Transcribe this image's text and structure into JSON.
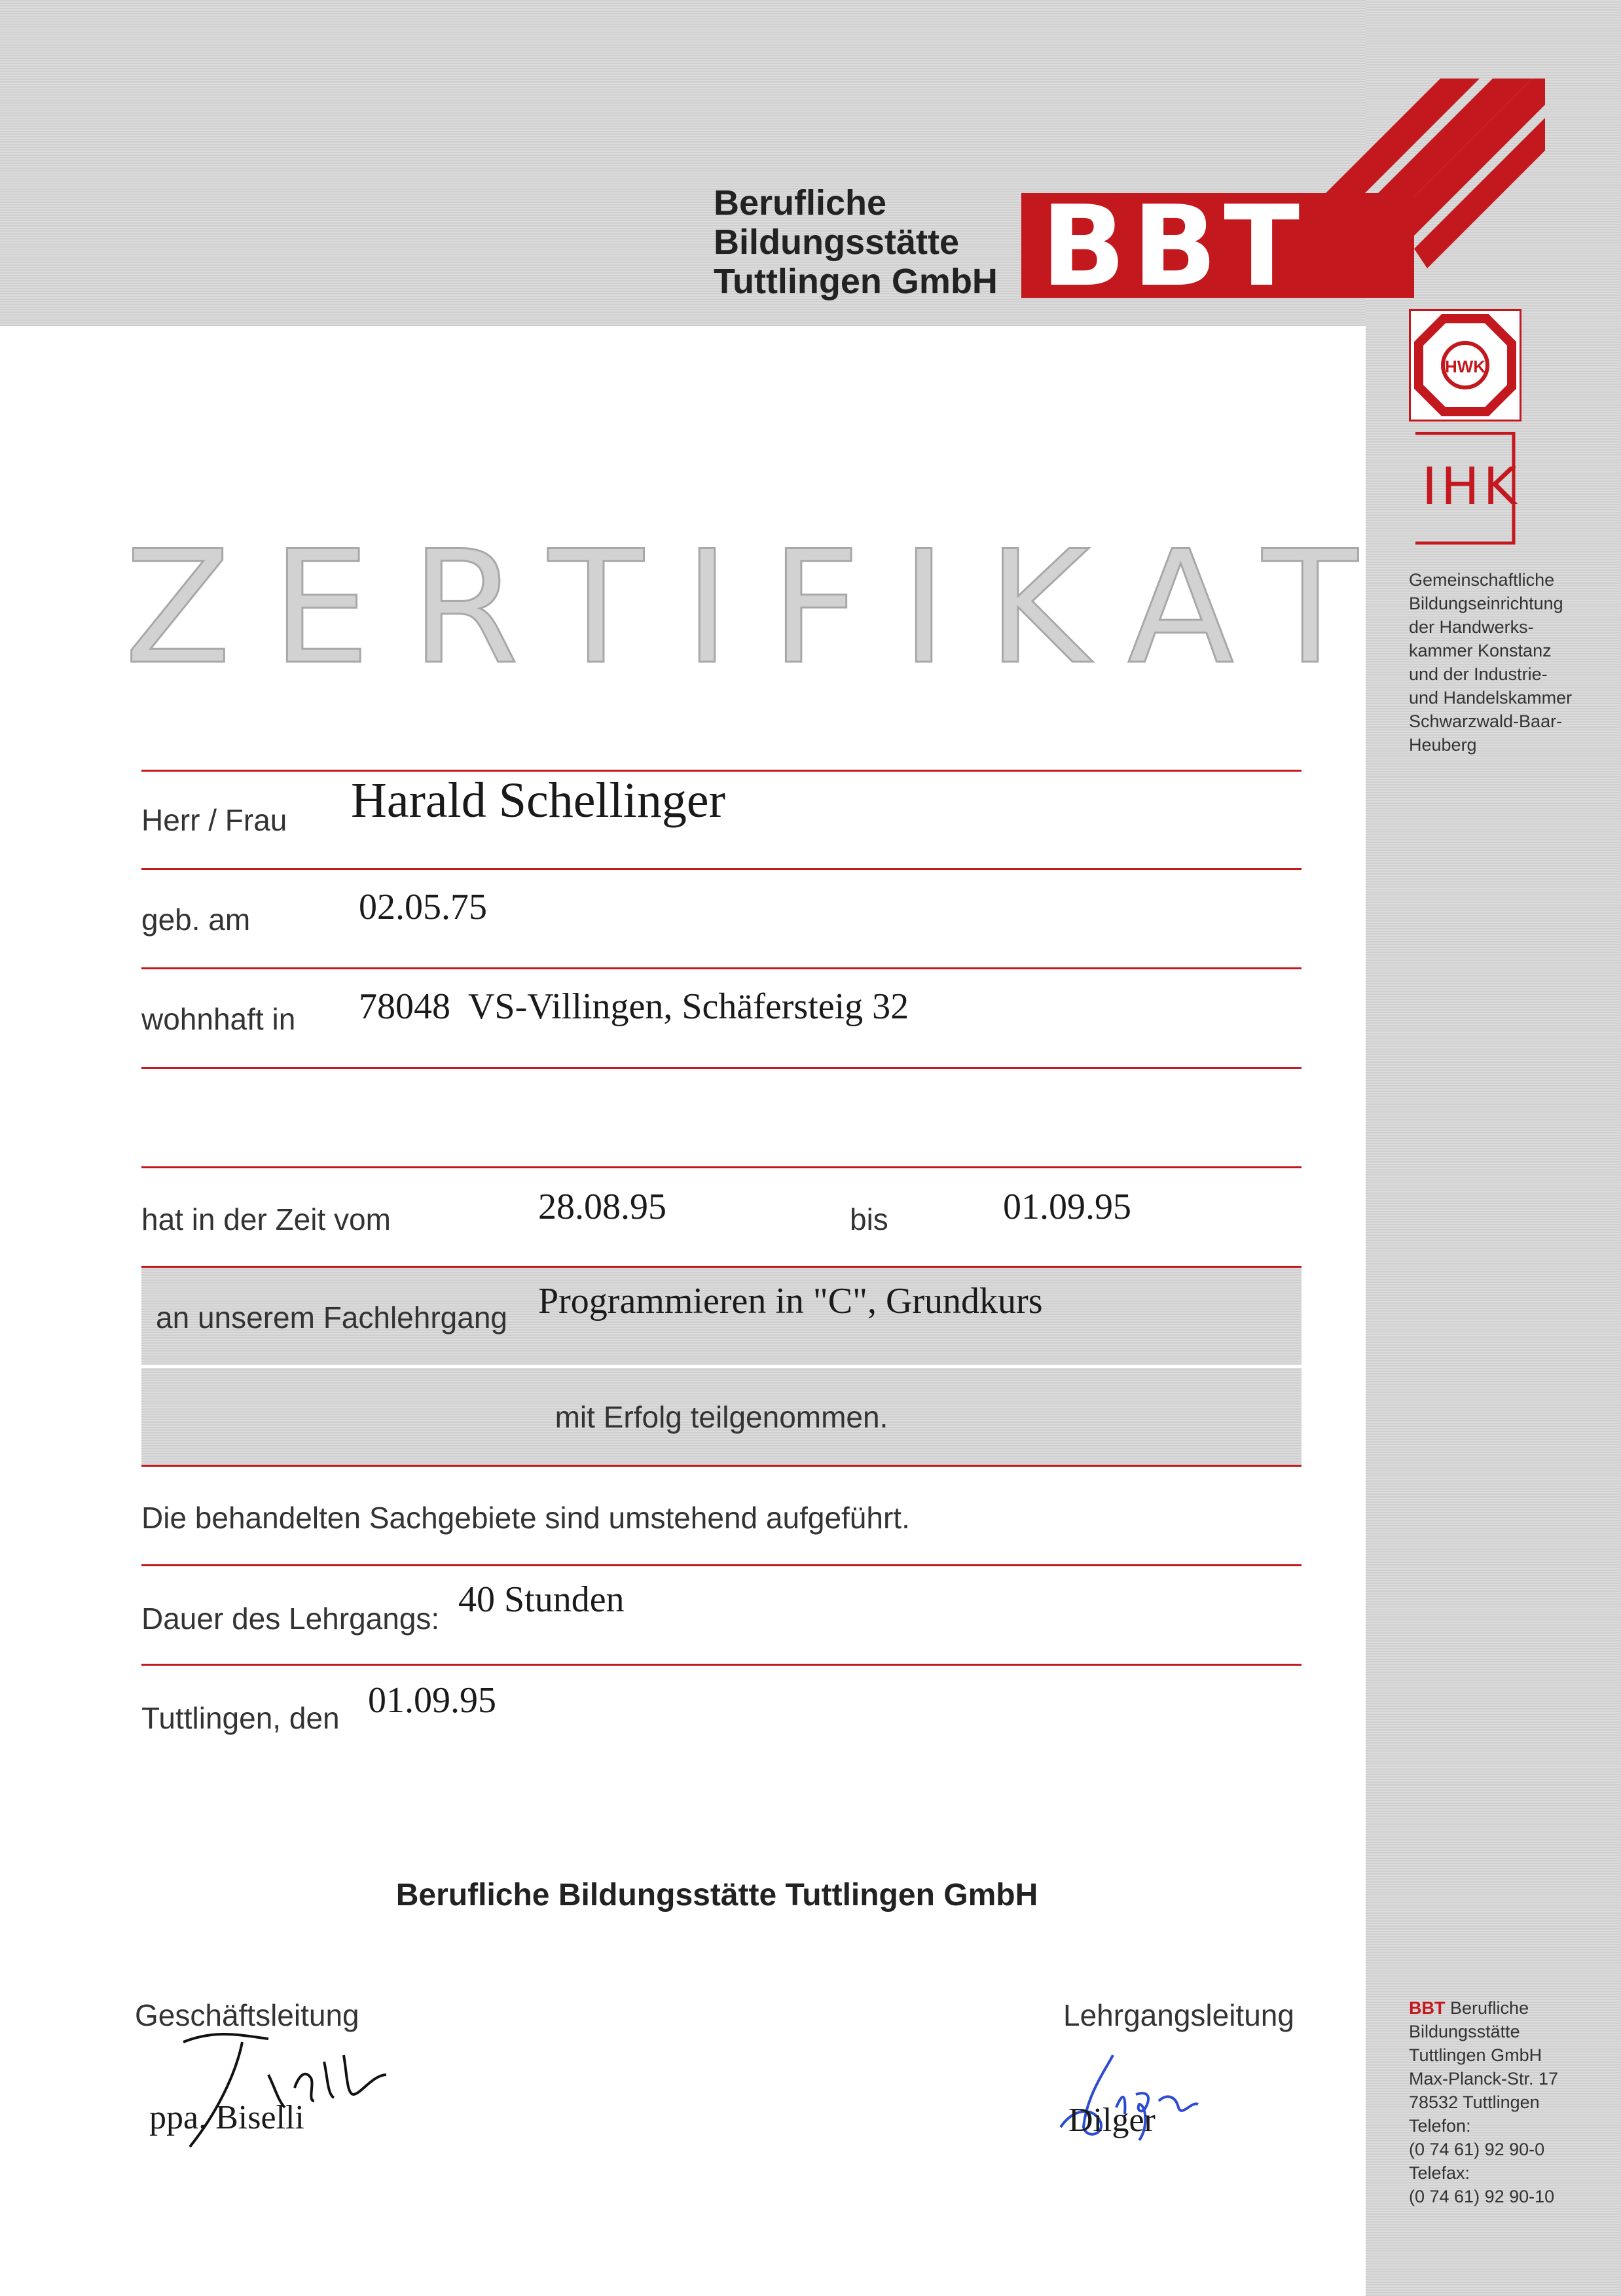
{
  "header": {
    "org_lines": [
      "Berufliche",
      "Bildungsstätte",
      "Tuttlingen GmbH"
    ],
    "logo_text": "BBT",
    "brand_color": "#c4181f"
  },
  "sidebar": {
    "hwk_label": "HWK",
    "ihk_label": "IHK",
    "note_lines": [
      "Gemeinschaftliche",
      "Bildungseinrichtung",
      "der Handwerks-",
      "kammer Konstanz",
      "und der Industrie-",
      "und Handelskammer",
      "Schwarzwald-Baar-",
      "Heuberg"
    ],
    "address_brand": "BBT",
    "address_first": "Berufliche",
    "address_lines": [
      "Bildungsstätte",
      "Tuttlingen GmbH",
      "Max-Planck-Str. 17",
      "78532 Tuttlingen",
      "Telefon:",
      "(0 74 61) 92 90-0",
      "Telefax:",
      "(0 74 61) 92 90-10"
    ]
  },
  "certificate": {
    "title": "ZERTIFIKAT",
    "name_label": "Herr / Frau",
    "name": "Harald Schellinger",
    "birth_label": "geb. am",
    "birth_date": "02.05.75",
    "residence_label": "wohnhaft in",
    "residence": "78048  VS-Villingen, Schäfersteig 32",
    "period_label": "hat in der Zeit vom",
    "period_from": "28.08.95",
    "period_to_label": "bis",
    "period_to": "01.09.95",
    "course_label": "an unserem Fachlehrgang",
    "course": "Programmieren in \"C\", Grundkurs",
    "success_text": "mit Erfolg teilgenommen.",
    "topics_note": "Die behandelten Sachgebiete sind umstehend aufgeführt.",
    "duration_label": "Dauer des Lehrgangs:",
    "duration": "40 Stunden",
    "place_label": "Tuttlingen, den",
    "place_date": "01.09.95"
  },
  "footer": {
    "org": "Berufliche Bildungsstätte Tuttlingen GmbH",
    "left_role": "Geschäftsleitung",
    "left_name": "ppa. Biselli",
    "right_role": "Lehrgangsleitung",
    "right_name": "Dilger"
  }
}
